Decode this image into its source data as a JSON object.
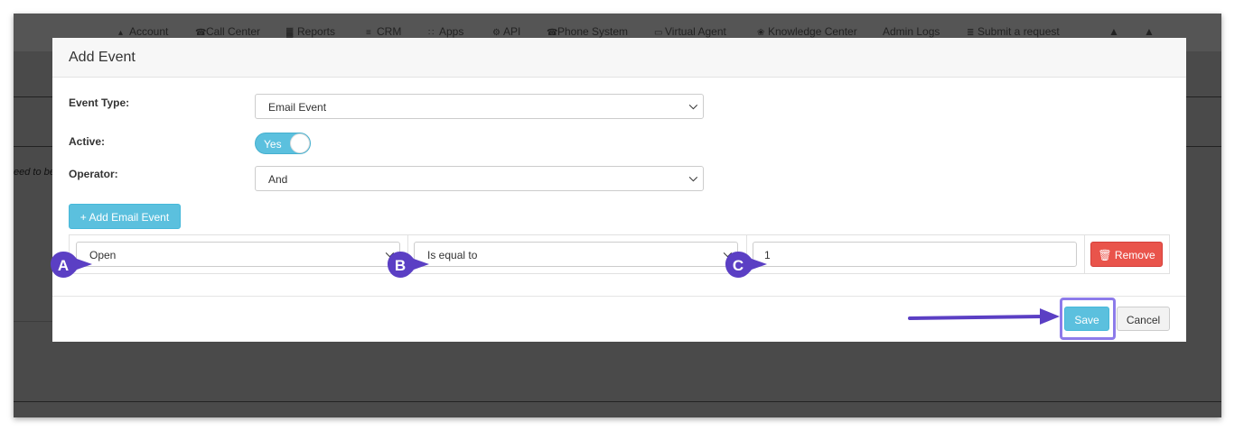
{
  "topnav": {
    "items": [
      {
        "icon": "user-icon",
        "glyph": "▴",
        "label": "Account"
      },
      {
        "icon": "phone-icon",
        "glyph": "☎",
        "label": "Call Center"
      },
      {
        "icon": "bar-chart-icon",
        "glyph": "▓",
        "label": "Reports"
      },
      {
        "icon": "list-icon",
        "glyph": "≡",
        "label": "CRM"
      },
      {
        "icon": "grid-icon",
        "glyph": "∷",
        "label": "Apps"
      },
      {
        "icon": "gear-icon",
        "glyph": "⚙",
        "label": "API"
      },
      {
        "icon": "phone-icon",
        "glyph": "☎",
        "label": "Phone System"
      },
      {
        "icon": "monitor-icon",
        "glyph": "▭",
        "label": "Virtual Agent"
      },
      {
        "icon": "lightbulb-icon",
        "glyph": "❀",
        "label": "Knowledge Center"
      },
      {
        "icon": "",
        "glyph": "",
        "label": "Admin Logs"
      },
      {
        "icon": "ticket-icon",
        "glyph": "≣",
        "label": "Submit a request"
      },
      {
        "icon": "bell-icon",
        "glyph": "▲",
        "label": ""
      },
      {
        "icon": "user-icon",
        "glyph": "▲",
        "label": ""
      }
    ]
  },
  "background": {
    "partial_text": "eed to be"
  },
  "modal": {
    "title": "Add Event",
    "event_type": {
      "label": "Event Type:",
      "value": "Email Event"
    },
    "active": {
      "label": "Active:",
      "toggle_text": "Yes",
      "on": true
    },
    "operator": {
      "label": "Operator:",
      "value": "And"
    },
    "add_button": "+ Add Email Event",
    "criteria": {
      "field": "Open",
      "comparison": "Is equal to",
      "value": "1",
      "remove_button": "🗑 Remove"
    },
    "save_button": "Save",
    "cancel_button": "Cancel"
  },
  "annotations": {
    "markers": [
      "A",
      "B",
      "C"
    ],
    "marker_color": "#5b3fc4",
    "arrow_color": "#5b3fc4",
    "highlight_color": "#8d7bea"
  },
  "colors": {
    "info": "#5bc0de",
    "danger": "#e9544b",
    "overlay": "#4a4a4a"
  }
}
